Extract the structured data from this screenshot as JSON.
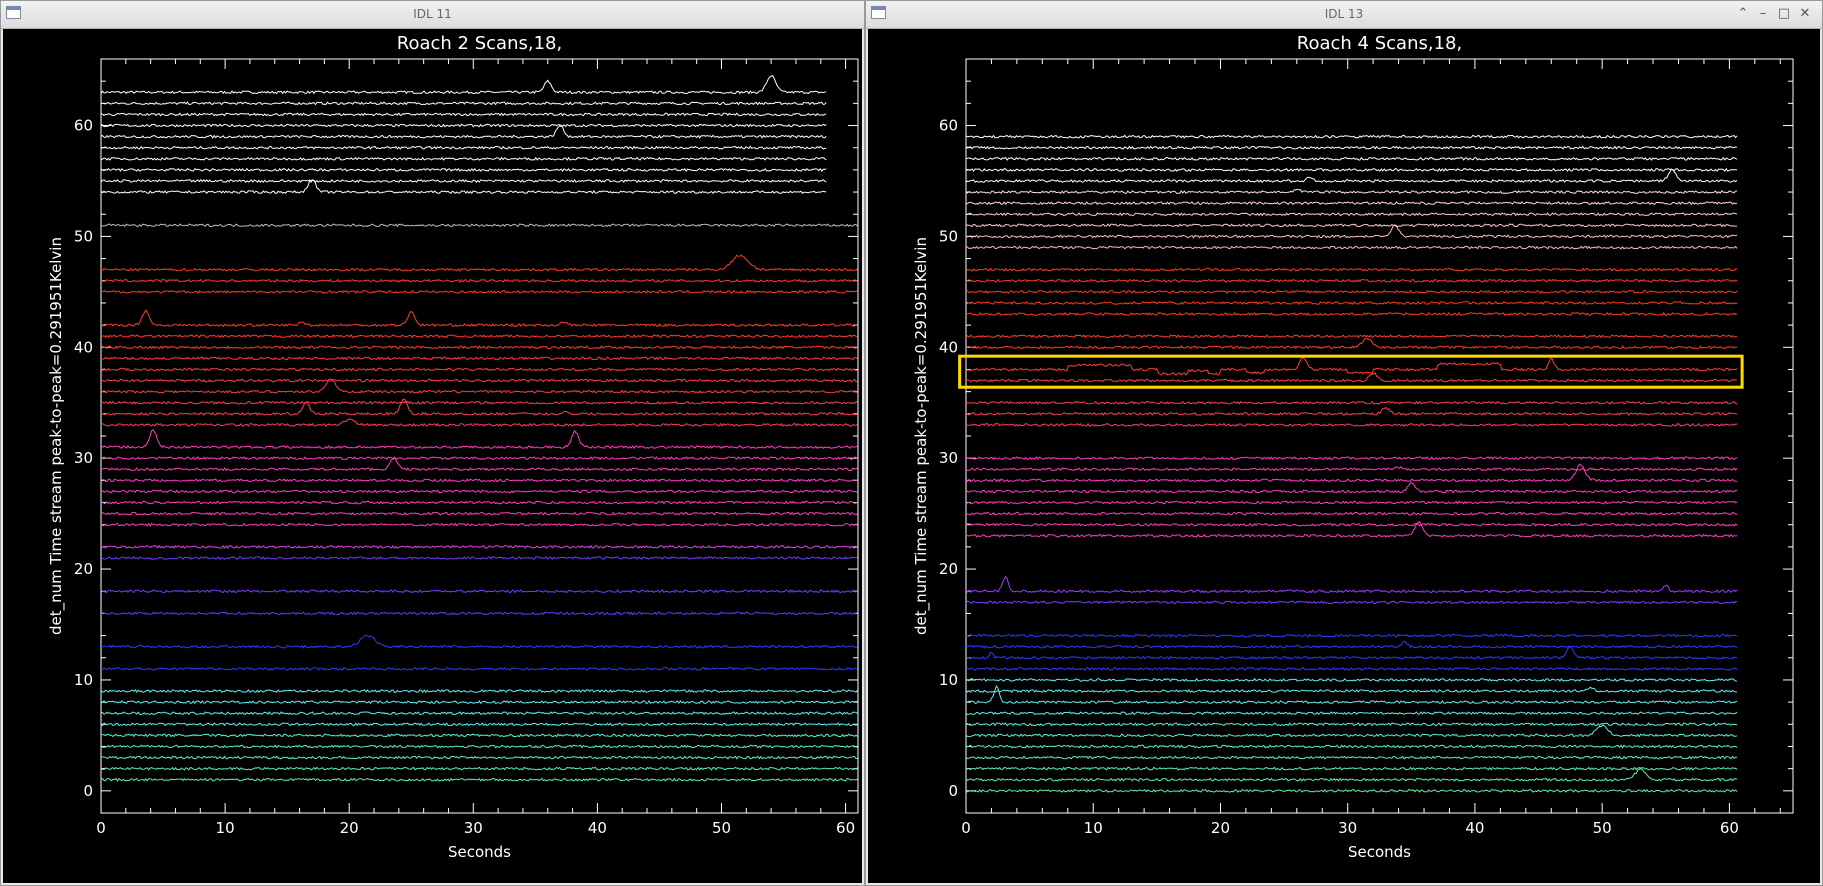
{
  "windows": [
    {
      "id": "left",
      "window_title": "IDL 11",
      "show_controls": false,
      "chart_data": {
        "type": "line",
        "title": "Roach 2 Scans,18,",
        "xlabel": "Seconds",
        "ylabel": "det_num Time stream peak-to-peak=0.291951Kelvin",
        "xlim": [
          0,
          61
        ],
        "ylim": [
          -2,
          66
        ],
        "xticks": [
          0,
          10,
          20,
          30,
          40,
          50,
          60
        ],
        "yticks": [
          0,
          10,
          20,
          30,
          40,
          50,
          60
        ],
        "grid": false,
        "highlight": null,
        "traces": [
          {
            "det": 63,
            "color": "#ffffff",
            "x_end": 58.5,
            "peaks": [
              [
                36,
                1.0,
                0.4
              ],
              [
                54,
                1.5,
                0.5
              ]
            ]
          },
          {
            "det": 62,
            "color": "#ffffff",
            "x_end": 58.5,
            "peaks": []
          },
          {
            "det": 61,
            "color": "#ffffff",
            "x_end": 58.5,
            "peaks": []
          },
          {
            "det": 60,
            "color": "#ffffff",
            "x_end": 58.5,
            "peaks": []
          },
          {
            "det": 59,
            "color": "#ffffff",
            "x_end": 58.5,
            "peaks": [
              [
                37,
                1.0,
                0.4
              ]
            ]
          },
          {
            "det": 58,
            "color": "#ffffff",
            "x_end": 58.5,
            "peaks": []
          },
          {
            "det": 57,
            "color": "#ffffff",
            "x_end": 58.5,
            "peaks": []
          },
          {
            "det": 56,
            "color": "#ffffff",
            "x_end": 58.5,
            "peaks": []
          },
          {
            "det": 55,
            "color": "#ffffff",
            "x_end": 58.5,
            "peaks": []
          },
          {
            "det": 54,
            "color": "#ffffff",
            "x_end": 58.5,
            "peaks": [
              [
                17,
                1.2,
                0.4
              ]
            ]
          },
          {
            "det": 51,
            "color": "#bbbbbb",
            "x_end": 61,
            "peaks": []
          },
          {
            "det": 47,
            "color": "#ff3b1f",
            "x_end": 61,
            "peaks": [
              [
                51.5,
                1.3,
                0.9
              ]
            ]
          },
          {
            "det": 46,
            "color": "#ff3b1f",
            "x_end": 61,
            "peaks": []
          },
          {
            "det": 45,
            "color": "#ff3b1f",
            "x_end": 61,
            "peaks": []
          },
          {
            "det": 42,
            "color": "#ff3b2a",
            "x_end": 61,
            "peaks": [
              [
                3.6,
                1.3,
                0.4
              ],
              [
                16.2,
                0.3,
                0.3
              ],
              [
                25,
                1.2,
                0.4
              ],
              [
                37.3,
                0.3,
                0.3
              ]
            ]
          },
          {
            "det": 41,
            "color": "#ff3b2a",
            "x_end": 61,
            "peaks": []
          },
          {
            "det": 40,
            "color": "#ff3b2a",
            "x_end": 61,
            "peaks": []
          },
          {
            "det": 39,
            "color": "#ff3c33",
            "x_end": 61,
            "peaks": []
          },
          {
            "det": 38,
            "color": "#ff3c3a",
            "x_end": 61,
            "peaks": []
          },
          {
            "det": 37,
            "color": "#ff3c3f",
            "x_end": 61,
            "peaks": []
          },
          {
            "det": 36,
            "color": "#ff3c45",
            "x_end": 61,
            "peaks": [
              [
                18.5,
                1.2,
                0.5
              ]
            ]
          },
          {
            "det": 35,
            "color": "#ff3c4d",
            "x_end": 61,
            "peaks": []
          },
          {
            "det": 34,
            "color": "#ff3c55",
            "x_end": 61,
            "peaks": [
              [
                16.5,
                1.0,
                0.4
              ],
              [
                24.4,
                1.3,
                0.4
              ],
              [
                37.5,
                0.2,
                0.3
              ]
            ]
          },
          {
            "det": 33,
            "color": "#ff3c5c",
            "x_end": 61,
            "peaks": [
              [
                20,
                0.5,
                0.6
              ]
            ]
          },
          {
            "det": 31,
            "color": "#ff3cbb",
            "x_end": 61,
            "peaks": [
              [
                4.2,
                1.5,
                0.4
              ],
              [
                38.2,
                1.4,
                0.4
              ]
            ]
          },
          {
            "det": 30,
            "color": "#ff3cbb",
            "x_end": 61,
            "peaks": []
          },
          {
            "det": 29,
            "color": "#ff3cbb",
            "x_end": 61,
            "peaks": [
              [
                23.6,
                1.0,
                0.4
              ]
            ]
          },
          {
            "det": 28,
            "color": "#ff3cbb",
            "x_end": 61,
            "peaks": []
          },
          {
            "det": 27,
            "color": "#ff3cbb",
            "x_end": 61,
            "peaks": []
          },
          {
            "det": 26,
            "color": "#ff3cbb",
            "x_end": 61,
            "peaks": []
          },
          {
            "det": 25,
            "color": "#ff3cbb",
            "x_end": 61,
            "peaks": []
          },
          {
            "det": 24,
            "color": "#ff3cbb",
            "x_end": 61,
            "peaks": []
          },
          {
            "det": 22,
            "color": "#e040e0",
            "x_end": 61,
            "peaks": []
          },
          {
            "det": 21,
            "color": "#6a3cff",
            "x_end": 61,
            "peaks": []
          },
          {
            "det": 18,
            "color": "#7a3cff",
            "x_end": 61,
            "peaks": []
          },
          {
            "det": 16,
            "color": "#5a3cff",
            "x_end": 61,
            "peaks": []
          },
          {
            "det": 13,
            "color": "#2b3cff",
            "x_end": 61,
            "peaks": [
              [
                21.5,
                1.0,
                0.8
              ]
            ]
          },
          {
            "det": 11,
            "color": "#2b3cff",
            "x_end": 61,
            "peaks": []
          },
          {
            "det": 9,
            "color": "#5ff0f0",
            "x_end": 61,
            "peaks": []
          },
          {
            "det": 8,
            "color": "#5ff0f0",
            "x_end": 61,
            "peaks": []
          },
          {
            "det": 7,
            "color": "#5ff0f0",
            "x_end": 61,
            "peaks": []
          },
          {
            "det": 6,
            "color": "#5ff0f0",
            "x_end": 61,
            "peaks": []
          },
          {
            "det": 5,
            "color": "#5ff0d0",
            "x_end": 61,
            "peaks": []
          },
          {
            "det": 4,
            "color": "#5ff0c0",
            "x_end": 61,
            "peaks": []
          },
          {
            "det": 3,
            "color": "#5ff0b8",
            "x_end": 61,
            "peaks": []
          },
          {
            "det": 2,
            "color": "#5ff0b0",
            "x_end": 61,
            "peaks": []
          },
          {
            "det": 1,
            "color": "#5ff0a8",
            "x_end": 61,
            "peaks": []
          }
        ]
      }
    },
    {
      "id": "right",
      "window_title": "IDL 13",
      "show_controls": true,
      "chart_data": {
        "type": "line",
        "title": "Roach 4 Scans,18,",
        "xlabel": "Seconds",
        "ylabel": "det_num Time stream peak-to-peak=0.291951Kelvin",
        "xlim": [
          0,
          65
        ],
        "ylim": [
          -2,
          66
        ],
        "xticks": [
          0,
          10,
          20,
          30,
          40,
          50,
          60
        ],
        "yticks": [
          0,
          10,
          20,
          30,
          40,
          50,
          60
        ],
        "grid": false,
        "highlight": {
          "x0": -0.5,
          "x1": 61,
          "y0": 36.4,
          "y1": 39.2,
          "color": "#ffd800"
        },
        "traces": [
          {
            "det": 59,
            "color": "#ffffff",
            "x_end": 60.7,
            "peaks": []
          },
          {
            "det": 58,
            "color": "#ffffff",
            "x_end": 60.7,
            "peaks": []
          },
          {
            "det": 57,
            "color": "#ffffff",
            "x_end": 60.7,
            "peaks": []
          },
          {
            "det": 56,
            "color": "#ffffff",
            "x_end": 60.7,
            "peaks": []
          },
          {
            "det": 55,
            "color": "#ffffff",
            "x_end": 60.7,
            "peaks": [
              [
                27,
                0.4,
                0.3
              ],
              [
                55.5,
                1.1,
                0.4
              ]
            ]
          },
          {
            "det": 54,
            "color": "#ffdede",
            "x_end": 60.7,
            "peaks": [
              [
                26,
                0.3,
                0.3
              ]
            ]
          },
          {
            "det": 53,
            "color": "#ffd6d6",
            "x_end": 60.7,
            "peaks": []
          },
          {
            "det": 52,
            "color": "#ffcece",
            "x_end": 60.7,
            "peaks": []
          },
          {
            "det": 51,
            "color": "#ffc6c6",
            "x_end": 60.7,
            "peaks": []
          },
          {
            "det": 50,
            "color": "#ffbebe",
            "x_end": 60.7,
            "peaks": [
              [
                33.7,
                1.1,
                0.4
              ]
            ]
          },
          {
            "det": 49,
            "color": "#ffb6b6",
            "x_end": 60.7,
            "peaks": []
          },
          {
            "det": 47,
            "color": "#ff3b1f",
            "x_end": 60.7,
            "peaks": []
          },
          {
            "det": 46,
            "color": "#ff3b1f",
            "x_end": 60.7,
            "peaks": []
          },
          {
            "det": 45,
            "color": "#ff3b1f",
            "x_end": 60.7,
            "peaks": []
          },
          {
            "det": 44,
            "color": "#ff3b1f",
            "x_end": 60.7,
            "peaks": []
          },
          {
            "det": 43,
            "color": "#ff3b25",
            "x_end": 60.7,
            "peaks": []
          },
          {
            "det": 41,
            "color": "#ff3b2a",
            "x_end": 60.7,
            "peaks": []
          },
          {
            "det": 40,
            "color": "#ff3b2a",
            "x_end": 60.7,
            "peaks": [
              [
                31.5,
                0.8,
                0.5
              ]
            ]
          },
          {
            "det": 38,
            "color": "#ff3b35",
            "x_end": 60.7,
            "peaks": [
              [
                26.5,
                1.1,
                0.4
              ],
              [
                46,
                1.0,
                0.3
              ]
            ],
            "steps": [
              [
                8,
                13,
                0.4
              ],
              [
                15,
                20,
                -0.4
              ],
              [
                17.5,
                19,
                0.3
              ],
              [
                22,
                23.5,
                -0.3
              ],
              [
                30,
                32,
                -0.3
              ],
              [
                37,
                42,
                0.5
              ]
            ]
          },
          {
            "det": 37,
            "color": "#ff3c3f",
            "x_end": 60.7,
            "peaks": [
              [
                32,
                0.7,
                0.4
              ]
            ]
          },
          {
            "det": 35,
            "color": "#ff3c50",
            "x_end": 60.7,
            "peaks": []
          },
          {
            "det": 34,
            "color": "#ff3c55",
            "x_end": 60.7,
            "peaks": [
              [
                33,
                0.5,
                0.4
              ]
            ]
          },
          {
            "det": 33,
            "color": "#ff3c5c",
            "x_end": 60.7,
            "peaks": []
          },
          {
            "det": 30,
            "color": "#ff3cbb",
            "x_end": 60.7,
            "peaks": []
          },
          {
            "det": 29,
            "color": "#ff3cbb",
            "x_end": 60.7,
            "peaks": [
              [
                34,
                0.2,
                0.3
              ]
            ]
          },
          {
            "det": 28,
            "color": "#ff3cbb",
            "x_end": 60.7,
            "peaks": [
              [
                48.3,
                1.4,
                0.5
              ]
            ]
          },
          {
            "det": 27,
            "color": "#ff3cbb",
            "x_end": 60.7,
            "peaks": [
              [
                35,
                0.7,
                0.4
              ]
            ]
          },
          {
            "det": 26,
            "color": "#ff3cbb",
            "x_end": 60.7,
            "peaks": []
          },
          {
            "det": 25,
            "color": "#ff3cbb",
            "x_end": 60.7,
            "peaks": []
          },
          {
            "det": 24,
            "color": "#ff3cbb",
            "x_end": 60.7,
            "peaks": []
          },
          {
            "det": 23,
            "color": "#ff3cbb",
            "x_end": 60.7,
            "peaks": [
              [
                35.6,
                1.3,
                0.4
              ]
            ]
          },
          {
            "det": 18,
            "color": "#9a3cff",
            "x_end": 60.7,
            "peaks": [
              [
                3.1,
                1.3,
                0.3
              ],
              [
                55,
                0.5,
                0.3
              ]
            ]
          },
          {
            "det": 17,
            "color": "#7a3cff",
            "x_end": 60.7,
            "peaks": []
          },
          {
            "det": 14,
            "color": "#2b3cff",
            "x_end": 60.7,
            "peaks": []
          },
          {
            "det": 13,
            "color": "#2b3cff",
            "x_end": 60.7,
            "peaks": [
              [
                34.5,
                0.4,
                0.3
              ]
            ]
          },
          {
            "det": 12,
            "color": "#2b3cff",
            "x_end": 60.7,
            "peaks": [
              [
                2,
                0.5,
                0.2
              ],
              [
                47.5,
                1.0,
                0.4
              ]
            ]
          },
          {
            "det": 11,
            "color": "#2b3cff",
            "x_end": 60.7,
            "peaks": []
          },
          {
            "det": 10,
            "color": "#5ff0f0",
            "x_end": 60.7,
            "peaks": []
          },
          {
            "det": 9,
            "color": "#5ff0f0",
            "x_end": 60.7,
            "peaks": [
              [
                49,
                0.3,
                0.4
              ]
            ]
          },
          {
            "det": 8,
            "color": "#5ff0f0",
            "x_end": 60.7,
            "peaks": [
              [
                2.4,
                1.4,
                0.3
              ]
            ]
          },
          {
            "det": 7,
            "color": "#5ff0f0",
            "x_end": 60.7,
            "peaks": []
          },
          {
            "det": 6,
            "color": "#5ff0e0",
            "x_end": 60.7,
            "peaks": []
          },
          {
            "det": 5,
            "color": "#5ff0c8",
            "x_end": 60.7,
            "peaks": [
              [
                50,
                0.9,
                0.6
              ]
            ]
          },
          {
            "det": 4,
            "color": "#5ff0c0",
            "x_end": 60.7,
            "peaks": []
          },
          {
            "det": 3,
            "color": "#5ff0b8",
            "x_end": 60.7,
            "peaks": []
          },
          {
            "det": 2,
            "color": "#5ff0b0",
            "x_end": 60.7,
            "peaks": []
          },
          {
            "det": 1,
            "color": "#5ff0a8",
            "x_end": 60.7,
            "peaks": [
              [
                53,
                0.9,
                0.6
              ]
            ]
          },
          {
            "det": 0,
            "color": "#5ff0a0",
            "x_end": 60.7,
            "peaks": []
          }
        ]
      }
    }
  ],
  "icons": {
    "minimize": "⌃",
    "restore": "–",
    "maximize": "□",
    "close": "✕"
  }
}
